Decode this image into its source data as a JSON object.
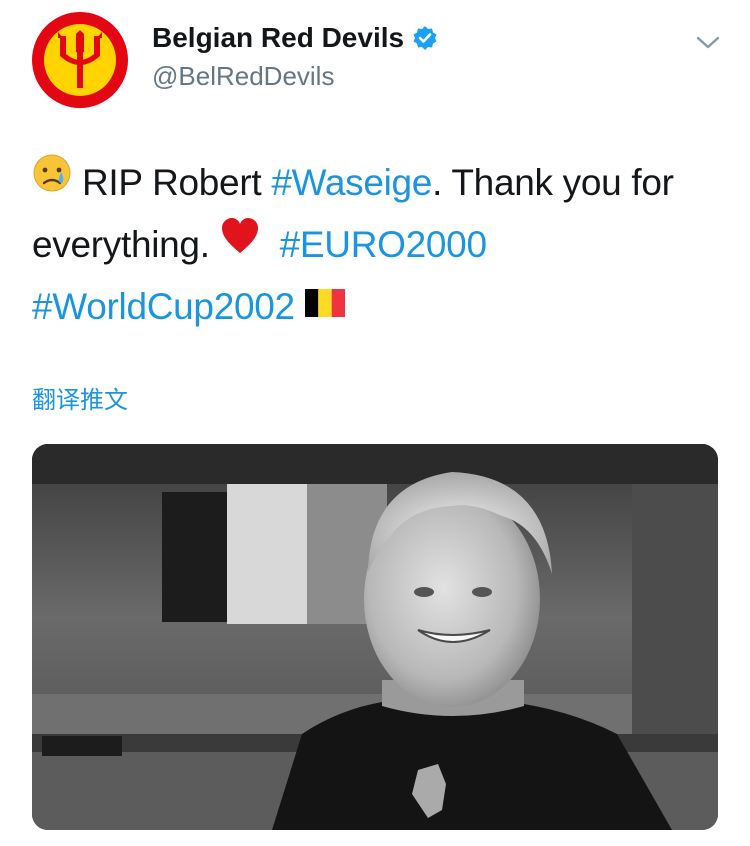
{
  "tweet": {
    "author": {
      "display_name": "Belgian Red Devils",
      "handle": "@BelRedDevils",
      "verified": true,
      "avatar_icon": "red-devil-trident-logo",
      "brand_colors": {
        "red": "#e30613",
        "yellow": "#ffd400"
      }
    },
    "text": {
      "part1": "RIP Robert ",
      "tag_waseige": "#Waseige",
      "part2": ". Thank you for everything. ",
      "tag_euro": "#EURO2000",
      "tag_worldcup": "#WorldCup2002",
      "emojis": [
        "crying-face",
        "red-heart",
        "belgium-flag"
      ]
    },
    "translate_label": "翻译推文",
    "media": {
      "icon": "photo-of-smiling-coach-in-black-and-white"
    },
    "menu_icon": "chevron-down-icon",
    "colors": {
      "link": "#1b95e0",
      "secondary": "#657786",
      "text": "#14171a"
    }
  }
}
